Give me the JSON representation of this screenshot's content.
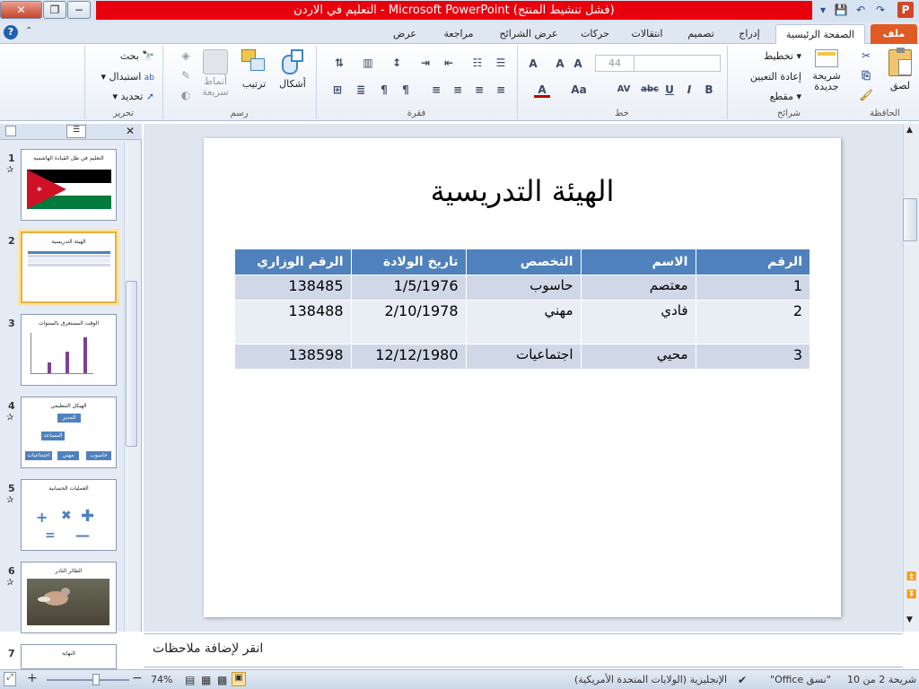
{
  "window": {
    "title": "التعليم في الاردن - Microsoft PowerPoint (فشل تنشيط المنتج)",
    "close": "✕",
    "max": "❐",
    "min": "−"
  },
  "qat": {
    "save": "💾",
    "undo": "↶",
    "redo": "↷",
    "more": "▾",
    "app": "P"
  },
  "tabs": [
    "ملف",
    "الصفحة الرئيسية",
    "إدراج",
    "تصميم",
    "انتقالات",
    "حركات",
    "عرض الشرائح",
    "مراجعة",
    "عرض"
  ],
  "ribbon": {
    "clipboard": {
      "name": "الحافظة",
      "paste": "لصق",
      "cut": "✂",
      "copy": "⎘",
      "format": "🖌"
    },
    "slides": {
      "name": "شرائح",
      "new_slide": "شريحة جديدة",
      "layout": "تخطيط",
      "reset": "إعادة التعيين",
      "section": "مقطع"
    },
    "font": {
      "name": "خط",
      "size": "44",
      "bold": "B",
      "italic": "I",
      "underline": "U",
      "strike": "abc",
      "spacing": "AV",
      "case": "Aa",
      "color": "A",
      "clear": "A"
    },
    "paragraph": {
      "name": "فقرة"
    },
    "drawing": {
      "name": "رسم",
      "shapes": "أشكال",
      "arrange": "ترتيب",
      "quick_styles": "أنماط سريعة"
    },
    "editing": {
      "name": "تحرير",
      "find": "بحث",
      "replace": "استبدال",
      "select": "تحديد"
    }
  },
  "thumbs": [
    {
      "num": "1",
      "title": "التعليم في ظل القيادة الهاشمية"
    },
    {
      "num": "2",
      "title": "الهيئة التدريسية"
    },
    {
      "num": "3",
      "title": "الوقت المستغرق بالسنوات"
    },
    {
      "num": "4",
      "title": "الهيكل التنظيمي",
      "boxes": [
        "المدير",
        "المساعد",
        "اجتماعيات",
        "مهني",
        "حاسوب"
      ]
    },
    {
      "num": "5",
      "title": "العمليات الحسابية"
    },
    {
      "num": "6",
      "title": "الطائر النادر"
    },
    {
      "num": "7",
      "title": "النهاية"
    }
  ],
  "slide": {
    "title": "الهيئة التدريسية",
    "headers": [
      "الرقم",
      "الاسم",
      "التخصص",
      "تاريخ الولادة",
      "الرقم الوزاري"
    ],
    "rows": [
      [
        "1",
        "معتصم",
        "حاسوب",
        "1/5/1976",
        "138485"
      ],
      [
        "2",
        "فادي",
        "مهني",
        "2/10/1978",
        "138488"
      ],
      [
        "3",
        "محيي",
        "اجتماعيات",
        "12/12/1980",
        "138598"
      ]
    ]
  },
  "notes": "انقر لإضافة ملاحظات",
  "status": {
    "slide_info": "شريحة 2 من 10",
    "theme": "\"نسق Office\"",
    "language": "الإنجليزية (الولايات المتحدة الأمريكية)",
    "zoom": "74%",
    "zoom_out": "−",
    "zoom_in": "+"
  },
  "colors": {
    "title_bar": "#e8000d",
    "file_tab": "#e05a24",
    "table_header": "#4f81bd",
    "row_dark": "#d0d8e8",
    "row_light": "#e9edf4"
  }
}
